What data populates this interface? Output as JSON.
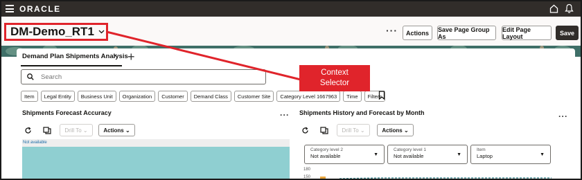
{
  "topbar": {
    "logo_text": "ORACLE",
    "menu_icon": "hamburger-menu-icon",
    "home_icon": "home-icon",
    "bell_icon": "notifications-bell-icon",
    "bg_color": "#312d2a"
  },
  "header": {
    "title": "DM-Demo_RT1",
    "title_chevron": "⌵",
    "more": "···",
    "buttons": {
      "actions": "Actions",
      "save_page_group_as": "Save Page Group As",
      "edit_page_layout": "Edit Page Layout",
      "save": "Save"
    }
  },
  "tabs": [
    {
      "label": "Demand Plan Shipments Analysis",
      "close": "×"
    }
  ],
  "tab_add": "+",
  "search": {
    "placeholder": "Search",
    "icon": "search-icon"
  },
  "filter_chips": [
    "Item",
    "Legal Entity",
    "Business Unit",
    "Organization",
    "Customer",
    "Demand Class",
    "Customer Site",
    "Category Level 1667963",
    "Time",
    "Filters"
  ],
  "left_panel": {
    "title": "Shipments Forecast Accuracy",
    "more": "···",
    "drill_to": "Drill To",
    "actions": "Actions",
    "not_available": "Not available"
  },
  "right_panel": {
    "title": "Shipments History and Forecast by Month",
    "more": "···",
    "drill_to": "Drill To",
    "actions": "Actions",
    "dropdowns": [
      {
        "label": "Category level 2",
        "value": "Not available"
      },
      {
        "label": "Category level 1",
        "value": "Not available"
      },
      {
        "label": "Item",
        "value": "Laptop"
      }
    ],
    "y_ticks": [
      "180",
      "150"
    ]
  },
  "callout": {
    "line1": "Context",
    "line2": "Selector",
    "color": "#e0242b"
  }
}
